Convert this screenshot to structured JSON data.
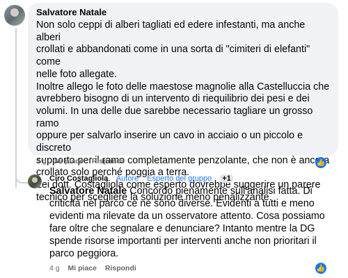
{
  "comment1": {
    "author": "Salvatore Natale",
    "text": "Non solo ceppi di alberi tagliati ed edere infestanti, ma anche alberi\ncrollati e abbandonati come in una sorta di \"cimiteri di elefanti\" come\nnelle foto allegate.\nInoltre allego le foto delle maestose magnolie alla Castelluccia che\navrebbero bisogno di un intervento di riequilibrio dei pesi e dei\nvolumi. In una delle due sarebbe necessario tagliare un grosso ramo\noppure per salvarlo inserire un cavo in acciaio o un piccolo e discreto\nsupporto per il ramo completamente penzolante, che non è ancora\ncrollato solo perché poggia a terra.\nLei dott. Costagliola come esperto dovrebbe suggerire un parere\ntecnico per scegliere la soluzione meno penalizzante.",
    "time": "4 g",
    "like_label": "Mi piace",
    "reply_label": "Rispondi"
  },
  "comment2": {
    "author": "Ciro Costagliola",
    "badge_author": "Autore",
    "badge_expert": "Esperto del gruppo",
    "badge_more": "+1",
    "mention": "Salvatore Natale",
    "text": " Concordo pienamente sull'analisi fatta. Di\ncriticità nel parco ce ne sono diverse. Evidenti a tutti e meno\nevidenti ma rilevate da un osservatore attento. Cosa possiamo\nfare oltre che segnalare e denunciare? Intanto mentre la DG\nspende risorse importanti per interventi anche non prioritari il\nparco peggiora.",
    "time": "4 g",
    "like_label": "Mi piace",
    "reply_label": "Rispondi"
  },
  "reaction_icon": "thumbs-up-icon",
  "colors": {
    "accent": "#1877f2",
    "bubble": "#f0f2f5",
    "meta": "#65676b"
  }
}
